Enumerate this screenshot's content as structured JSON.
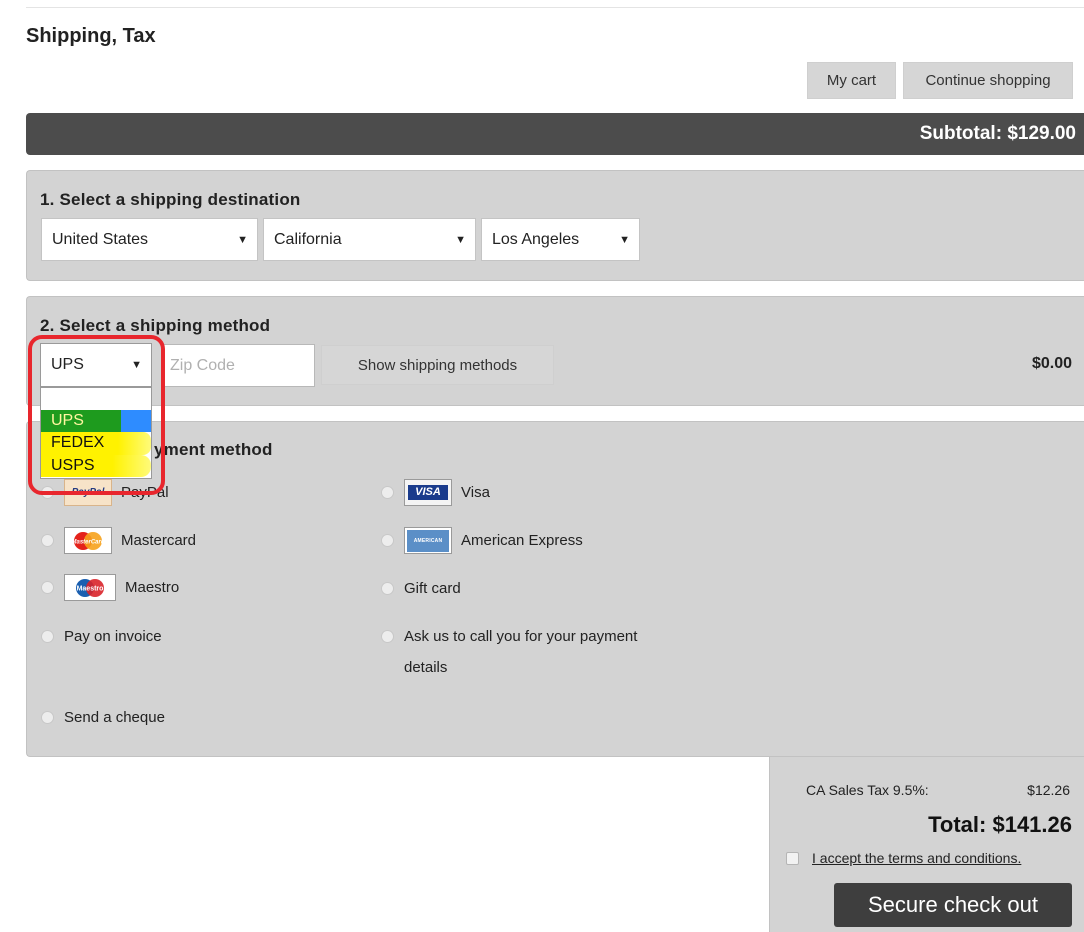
{
  "page": {
    "title": "Shipping, Tax"
  },
  "header_buttons": {
    "my_cart": "My cart",
    "continue_shopping": "Continue shopping"
  },
  "subtotal": {
    "label": "Subtotal: $129.00"
  },
  "destination": {
    "title": "1. Select a shipping destination",
    "country": "United States",
    "state": "California",
    "city": "Los Angeles"
  },
  "shipping_method": {
    "title": "2. Select a shipping method",
    "carrier": "UPS",
    "zip_placeholder": "Zip Code",
    "show_button": "Show shipping methods",
    "price": "$0.00",
    "dropdown_options": [
      "UPS",
      "FEDEX",
      "USPS"
    ],
    "highlight_colors": {
      "green": "#1e9b1e",
      "blue": "#2e8cff",
      "yellow": "#fff200",
      "ring": "#e8262d"
    }
  },
  "payment": {
    "title_visible": "yment method",
    "methods": [
      {
        "label": "PayPal",
        "logo_text": "PayPal"
      },
      {
        "label": "Visa",
        "logo_text": "VISA"
      },
      {
        "label": "Mastercard",
        "logo_text": "MasterCard"
      },
      {
        "label": "American Express",
        "logo_text": "AMERICAN EXPRESS"
      },
      {
        "label": "Maestro",
        "logo_text": "Maestro"
      },
      {
        "label": "Gift card"
      },
      {
        "label": "Pay on invoice"
      },
      {
        "label": "Ask us to call you for your payment details",
        "line1": "Ask us to call you for your payment",
        "line2": "details"
      },
      {
        "label": "Send a cheque"
      }
    ]
  },
  "totals": {
    "tax_label": "CA Sales Tax 9.5%:",
    "tax_value": "$12.26",
    "total_label": "Total:",
    "total_value": "$141.26",
    "terms_label": "I accept the terms and conditions.",
    "checkout_button": "Secure check out"
  }
}
